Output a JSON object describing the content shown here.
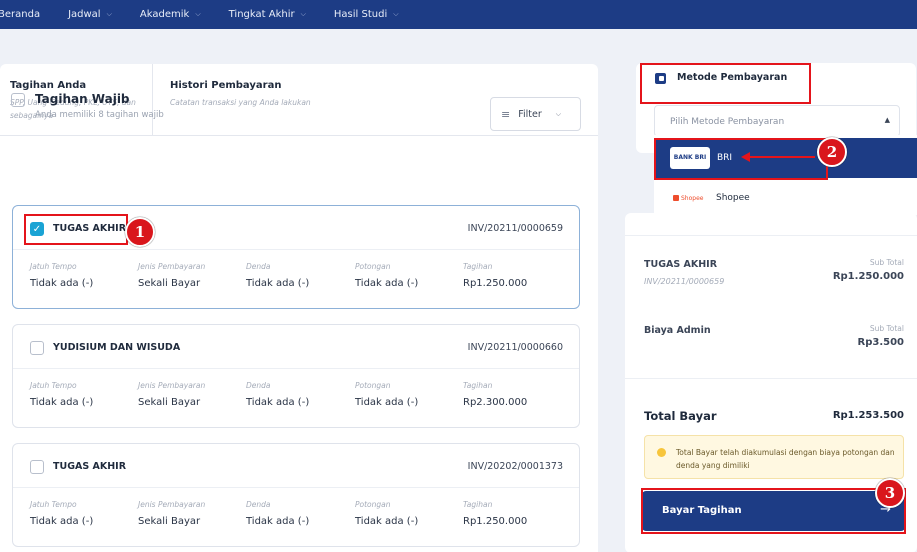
{
  "nav": {
    "items": [
      {
        "label": "Beranda",
        "chevron": false
      },
      {
        "label": "Jadwal",
        "chevron": true
      },
      {
        "label": "Akademik",
        "chevron": true
      },
      {
        "label": "Tingkat Akhir",
        "chevron": true
      },
      {
        "label": "Hasil Studi",
        "chevron": true
      }
    ]
  },
  "tabs": {
    "tagihan_title": "Tagihan Anda",
    "tagihan_sub": "SPP, Uang Gedung, PKL, UTS, dan sebagainya",
    "histori_title": "Histori Pembayaran",
    "histori_sub": "Catatan transaksi yang Anda lakukan"
  },
  "wajib": {
    "title": "Tagihan Wajib",
    "subtitle": "Anda memiliki 8 tagihan wajib",
    "filter_label": "Filter"
  },
  "columns": [
    "Jatuh Tempo",
    "Jenis Pembayaran",
    "Denda",
    "Potongan",
    "Tagihan"
  ],
  "bills": [
    {
      "title": "TUGAS AKHIR",
      "invoice": "INV/20211/0000659",
      "checked": true,
      "values": [
        "Tidak ada (-)",
        "Sekali Bayar",
        "Tidak ada (-)",
        "Tidak ada (-)",
        "Rp1.250.000"
      ]
    },
    {
      "title": "YUDISIUM DAN WISUDA",
      "invoice": "INV/20211/0000660",
      "checked": false,
      "values": [
        "Tidak ada (-)",
        "Sekali Bayar",
        "Tidak ada (-)",
        "Tidak ada (-)",
        "Rp2.300.000"
      ]
    },
    {
      "title": "TUGAS AKHIR",
      "invoice": "INV/20202/0001373",
      "checked": false,
      "values": [
        "Tidak ada (-)",
        "Sekali Bayar",
        "Tidak ada (-)",
        "Tidak ada (-)",
        "Rp1.250.000"
      ]
    }
  ],
  "method": {
    "title": "Metode Pembayaran",
    "placeholder": "Pilih Metode Pembayaran",
    "options": [
      {
        "label": "BRI",
        "logo_text": "BANK BRI",
        "selected": true
      },
      {
        "label": "Shopee",
        "logo_text": "Shopee",
        "selected": false
      }
    ]
  },
  "summary": {
    "item_name": "TUGAS AKHIR",
    "item_invoice": "INV/20211/0000659",
    "item_sub_label": "Sub Total",
    "item_sub_value": "Rp1.250.000",
    "admin_name": "Biaya Admin",
    "admin_sub_label": "Sub Total",
    "admin_sub_value": "Rp3.500",
    "total_label": "Total Bayar",
    "total_value": "Rp1.253.500",
    "notice": "Total Bayar telah diakumulasi dengan biaya potongan dan denda yang dimiliki",
    "pay_label": "Bayar Tagihan",
    "pay_arrow": "→"
  },
  "annotations": {
    "badge1": "1",
    "badge2": "2",
    "badge3": "3"
  },
  "colors": {
    "primary": "#1d3c85",
    "accent_check": "#1aa3d4",
    "highlight": "#e4141b"
  }
}
